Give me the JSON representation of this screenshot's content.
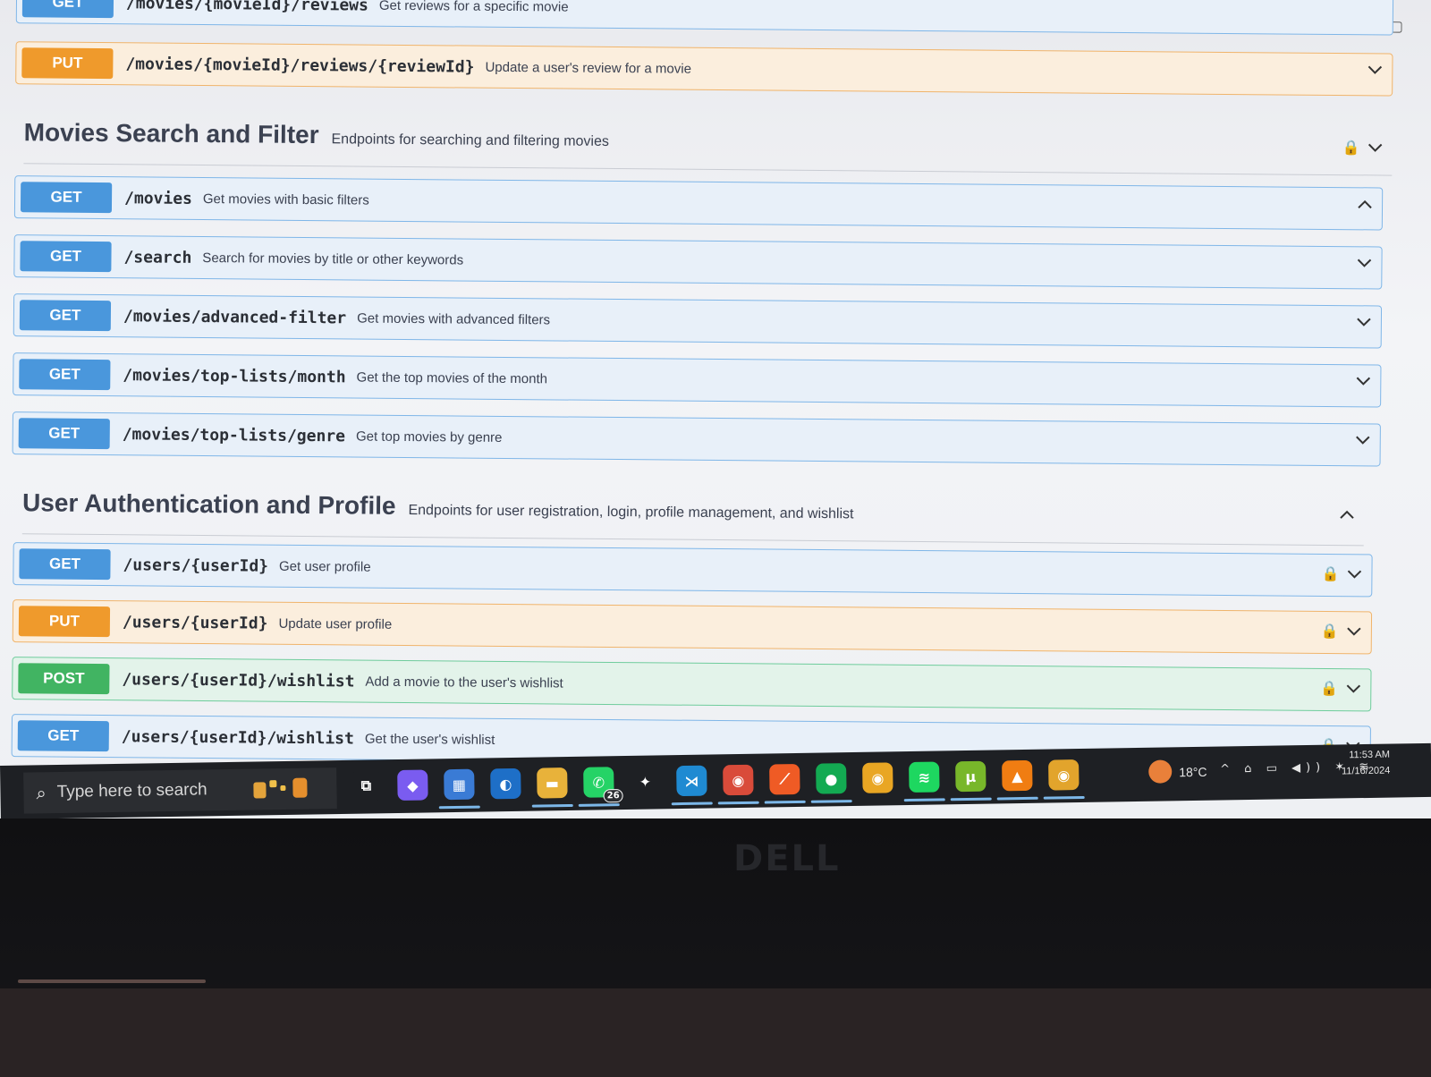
{
  "window_controls": {
    "close": "×",
    "new_tab": "+",
    "minimize": "–",
    "restore": "▢"
  },
  "browser_toolbar": {
    "bookmark_icon": "star-icon",
    "extensions_icon": "puzzle-icon"
  },
  "top_ops": [
    {
      "method": "GET",
      "path": "/movies/{movieId}/reviews",
      "summary": "Get reviews for a specific movie",
      "kind": "get"
    },
    {
      "method": "PUT",
      "path": "/movies/{movieId}/reviews/{reviewId}",
      "summary": "Update a user's review for a movie",
      "kind": "put"
    }
  ],
  "sections": [
    {
      "title": "Movies Search and Filter",
      "description": "Endpoints for searching and filtering movies",
      "operations": [
        {
          "method": "GET",
          "path": "/movies",
          "summary": "Get movies with basic filters",
          "kind": "get",
          "expanded": true
        },
        {
          "method": "GET",
          "path": "/search",
          "summary": "Search for movies by title or other keywords",
          "kind": "get"
        },
        {
          "method": "GET",
          "path": "/movies/advanced-filter",
          "summary": "Get movies with advanced filters",
          "kind": "get"
        },
        {
          "method": "GET",
          "path": "/movies/top-lists/month",
          "summary": "Get the top movies of the month",
          "kind": "get"
        },
        {
          "method": "GET",
          "path": "/movies/top-lists/genre",
          "summary": "Get top movies by genre",
          "kind": "get"
        }
      ]
    },
    {
      "title": "User Authentication and Profile",
      "description": "Endpoints for user registration, login, profile management, and wishlist",
      "operations": [
        {
          "method": "GET",
          "path": "/users/{userId}",
          "summary": "Get user profile",
          "kind": "get",
          "locked": true
        },
        {
          "method": "PUT",
          "path": "/users/{userId}",
          "summary": "Update user profile",
          "kind": "put",
          "locked": true
        },
        {
          "method": "POST",
          "path": "/users/{userId}/wishlist",
          "summary": "Add a movie to the user's wishlist",
          "kind": "post",
          "locked": true
        },
        {
          "method": "GET",
          "path": "/users/{userId}/wishlist",
          "summary": "Get the user's wishlist",
          "kind": "get",
          "locked": true
        }
      ]
    }
  ],
  "taskbar": {
    "search_placeholder": "Type here to search",
    "apps": [
      {
        "name": "task-view-icon",
        "glyph": "⧉",
        "color": "#1e2024"
      },
      {
        "name": "copilot-icon",
        "glyph": "◆",
        "color": "#7a5cf0"
      },
      {
        "name": "store-icon",
        "glyph": "▦",
        "color": "#3a7bd5",
        "active": true
      },
      {
        "name": "edge-icon",
        "glyph": "◐",
        "color": "#1e6fc7"
      },
      {
        "name": "file-explorer-icon",
        "glyph": "▬",
        "color": "#e8b23a",
        "active": true
      },
      {
        "name": "whatsapp-icon",
        "glyph": "✆",
        "color": "#25d366",
        "badge": "26",
        "active": true
      },
      {
        "name": "app-icon",
        "glyph": "✦",
        "color": "#1e2024"
      },
      {
        "name": "vscode-icon",
        "glyph": "⋊",
        "color": "#1f8ad2",
        "active": true
      },
      {
        "name": "chrome-icon",
        "glyph": "◉",
        "color": "#d94b3a",
        "active": true
      },
      {
        "name": "postman-icon",
        "glyph": "⟋",
        "color": "#ef5b25",
        "active": true
      },
      {
        "name": "mongodb-compass-icon",
        "glyph": "●",
        "color": "#13aa52",
        "active": true
      },
      {
        "name": "chrome-icon",
        "glyph": "◉",
        "color": "#e9a623"
      },
      {
        "name": "spotify-icon",
        "glyph": "≋",
        "color": "#1ed760",
        "active": true
      },
      {
        "name": "utorrent-icon",
        "glyph": "µ",
        "color": "#78b72a",
        "active": true
      },
      {
        "name": "vlc-icon",
        "glyph": "▲",
        "color": "#f07d12",
        "active": true
      },
      {
        "name": "chrome-canary-icon",
        "glyph": "◉",
        "color": "#e2a42c",
        "active": true
      }
    ],
    "weather": "18°C",
    "time": "11:53 AM",
    "date": "11/16/2024"
  },
  "hardware": {
    "brand": "DELL"
  }
}
